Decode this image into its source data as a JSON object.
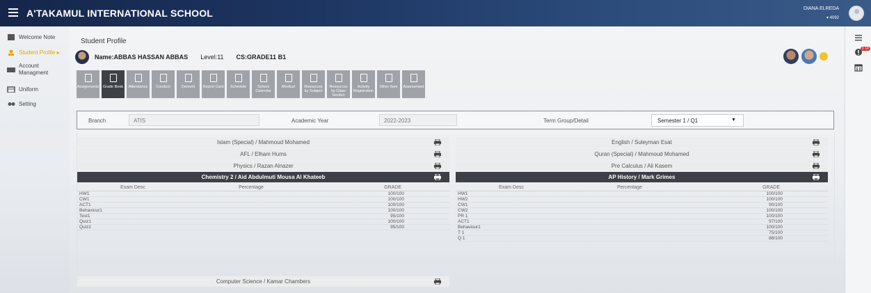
{
  "header": {
    "school_name": "A'TAKAMUL INTERNATIONAL SCHOOL",
    "user_name": "DIANA ELREDA",
    "user_code": "▾ 4092"
  },
  "sidebar": {
    "items": [
      {
        "label": "Welcome Note",
        "icon": "note-icon"
      },
      {
        "label": "Student Profile ▸",
        "icon": "student-icon"
      },
      {
        "label": "Account Managment",
        "icon": "account-icon"
      },
      {
        "label": "Uniform",
        "icon": "uniform-icon"
      },
      {
        "label": "Setting",
        "icon": "setting-icon"
      }
    ]
  },
  "rail": {
    "badge": "0 18"
  },
  "page": {
    "title": "Student Profile"
  },
  "student": {
    "name": "Name:ABBAS HASSAN ABBAS",
    "level": "Level:11",
    "class": "CS:GRADE11 B1"
  },
  "tools": [
    {
      "label": "Assignments"
    },
    {
      "label": "Grade Book"
    },
    {
      "label": "Attendance"
    },
    {
      "label": "Conduct"
    },
    {
      "label": "Demerit"
    },
    {
      "label": "Report Card"
    },
    {
      "label": "Schedule"
    },
    {
      "label": "School Calendar"
    },
    {
      "label": "Medical"
    },
    {
      "label": "Resources by Subject"
    },
    {
      "label": "Resources by Class Section"
    },
    {
      "label": "Activity Registration"
    },
    {
      "label": "Other Item"
    },
    {
      "label": "Assessment"
    }
  ],
  "filter": {
    "branch_label": "Branch",
    "branch_value": "ATIS",
    "year_label": "Academic Year",
    "year_value": "2022-2023",
    "term_label": "Term Group/Detail",
    "term_value": "Semester 1 / Q1"
  },
  "left_subjects": [
    "Islam (Special) / Mahmoud Mohamed",
    "AFL / Elham Hums",
    "Physics / Razan Alnazer",
    "Chemistry 2 / Aid Abdulmuti Mousa Al Khateeb"
  ],
  "right_subjects": [
    "English / Suleyman Esat",
    "Quran (Special) / Mahmoud Mohamed",
    "Pre Calculus / Ali Kasem",
    "AP History / Mark Grimes"
  ],
  "table_headers": {
    "exam": "Exam Desc",
    "percentage": "Percentage",
    "grade": "GRADE"
  },
  "left_grades": [
    {
      "exam": "HW1",
      "percentage": "",
      "grade": "100/100"
    },
    {
      "exam": "CW1",
      "percentage": "",
      "grade": "100/100"
    },
    {
      "exam": "ACT1",
      "percentage": "",
      "grade": "100/100"
    },
    {
      "exam": "Behaviour1",
      "percentage": "",
      "grade": "100/100"
    },
    {
      "exam": "Test1",
      "percentage": "",
      "grade": "95/100"
    },
    {
      "exam": "Quiz1",
      "percentage": "",
      "grade": "100/100"
    },
    {
      "exam": "Quiz2",
      "percentage": "",
      "grade": "95/100"
    }
  ],
  "right_grades": [
    {
      "exam": "HW1",
      "percentage": "",
      "grade": "100/100"
    },
    {
      "exam": "HW2",
      "percentage": "",
      "grade": "100/100"
    },
    {
      "exam": "CW1",
      "percentage": "",
      "grade": "90/100"
    },
    {
      "exam": "CW2",
      "percentage": "",
      "grade": "100/100"
    },
    {
      "exam": "PR 1",
      "percentage": "",
      "grade": "100/100"
    },
    {
      "exam": "ACT1",
      "percentage": "",
      "grade": "97/100"
    },
    {
      "exam": "Behaviour1",
      "percentage": "",
      "grade": "100/100"
    },
    {
      "exam": "T 1",
      "percentage": "",
      "grade": "75/100"
    },
    {
      "exam": "Q 1",
      "percentage": "",
      "grade": "88/100"
    }
  ],
  "last_subject": "Computer Science / Kamar Chambers"
}
